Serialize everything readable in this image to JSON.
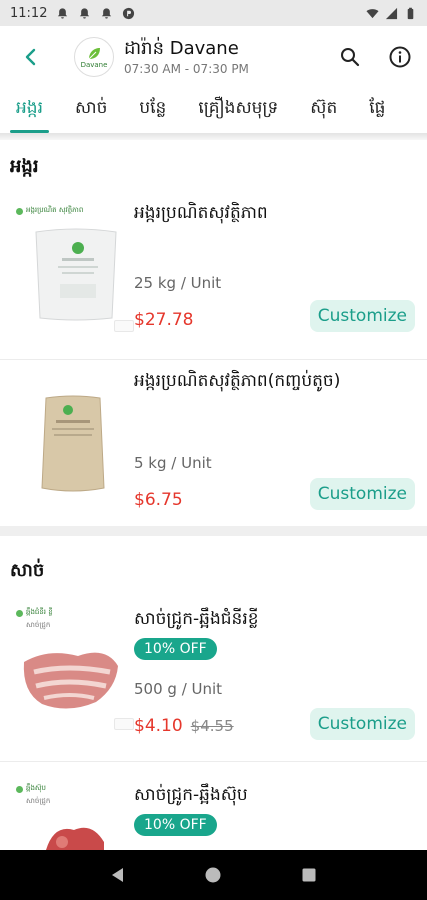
{
  "status_bar": {
    "time": "11:12"
  },
  "header": {
    "store_name": "ដារ៉ាន់ Davane",
    "store_hours": "07:30 AM - 07:30 PM",
    "logo_text": "Davane"
  },
  "tabs": [
    {
      "label": "អង្ករ",
      "active": true
    },
    {
      "label": "សាច់",
      "active": false
    },
    {
      "label": "បន្លែ",
      "active": false
    },
    {
      "label": "គ្រឿងសមុទ្រ",
      "active": false
    },
    {
      "label": "ស៊ុត",
      "active": false
    },
    {
      "label": "ផ្លែ",
      "active": false
    }
  ],
  "sections": [
    {
      "title": "អង្ករ",
      "products": [
        {
          "name": "អង្ករប្រណិតសុវត្ថិភាព",
          "unit": "25 kg / Unit",
          "price": "$27.78",
          "button": "Customize",
          "image_brand": "អង្ករប្រណិត សុវត្ថិភាព"
        },
        {
          "name": "អង្ករប្រណិតសុវត្ថិភាព(កញ្ចប់តូច)",
          "unit": "5 kg / Unit",
          "price": "$6.75",
          "button": "Customize"
        }
      ]
    },
    {
      "title": "សាច់",
      "products": [
        {
          "name": "សាច់ជ្រូក-ឆ្អឹងជំនីរខ្លី",
          "discount": "10% OFF",
          "unit": "500 g / Unit",
          "price": "$4.10",
          "old_price": "$4.55",
          "button": "Customize",
          "image_brand": "ឆ្អឹងជំនីរ ខ្លី",
          "image_sub": "សាច់ជ្រូក"
        },
        {
          "name": "សាច់ជ្រូក-ឆ្អឹងស៊ុប",
          "discount": "10% OFF",
          "image_brand": "ឆ្អឹងស៊ុប",
          "image_sub": "សាច់ជ្រូក"
        }
      ]
    }
  ],
  "colors": {
    "accent": "#1b9e8a",
    "price": "#e5372c",
    "badge": "#19a68c",
    "button_bg": "#dff4ee"
  }
}
